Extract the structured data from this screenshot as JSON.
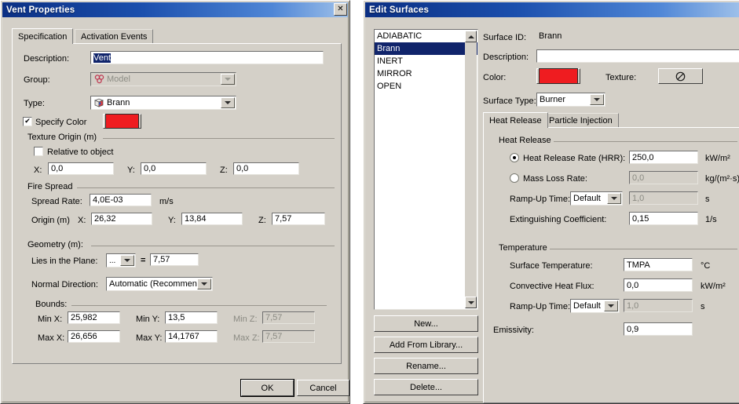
{
  "vent_dialog": {
    "title": "Vent Properties",
    "close_icon": "close-icon",
    "tabs": [
      {
        "label": "Specification",
        "active": true
      },
      {
        "label": "Activation Events",
        "active": false
      }
    ],
    "fields": {
      "description_label": "Description:",
      "description_value": "Vent",
      "group_label": "Group:",
      "group_value": "Model",
      "type_label": "Type:",
      "type_value": "Brann",
      "specify_color_label": "Specify Color",
      "specify_color_checked": "✔",
      "color_swatch": "#ef1c20"
    },
    "texture_origin": {
      "title": "Texture Origin (m)",
      "relative_label": "Relative to object",
      "x_label": "X:",
      "x_value": "0,0",
      "y_label": "Y:",
      "y_value": "0,0",
      "z_label": "Z:",
      "z_value": "0,0"
    },
    "fire_spread": {
      "title": "Fire Spread",
      "spread_rate_label": "Spread Rate:",
      "spread_rate_value": "4,0E-03",
      "spread_rate_unit": "m/s",
      "origin_label": "Origin (m)",
      "x_label": "X:",
      "x_value": "26,32",
      "y_label": "Y:",
      "y_value": "13,84",
      "z_label": "Z:",
      "z_value": "7,57"
    },
    "geometry": {
      "title": "Geometry (m):",
      "plane_label": "Lies in the Plane:",
      "plane_value": "...",
      "equals": "=",
      "plane_coord": "7,57",
      "normal_label": "Normal Direction:",
      "normal_value": "Automatic (Recommend...",
      "bounds_title": "Bounds:",
      "min_x_label": "Min X:",
      "min_x_value": "25,982",
      "min_y_label": "Min Y:",
      "min_y_value": "13,5",
      "min_z_label": "Min Z:",
      "min_z_value": "7,57",
      "max_x_label": "Max X:",
      "max_x_value": "26,656",
      "max_y_label": "Max Y:",
      "max_y_value": "14,1767",
      "max_z_label": "Max Z:",
      "max_z_value": "7,57"
    },
    "buttons": {
      "ok": "OK",
      "cancel": "Cancel"
    }
  },
  "surfaces_dialog": {
    "title": "Edit Surfaces",
    "list": {
      "items": [
        "ADIABATIC",
        "Brann",
        "INERT",
        "MIRROR",
        "OPEN"
      ],
      "selected": "Brann"
    },
    "list_buttons": [
      {
        "label": "New..."
      },
      {
        "label": "Add From Library..."
      },
      {
        "label": "Rename..."
      },
      {
        "label": "Delete..."
      }
    ],
    "fields": {
      "surface_id_label": "Surface ID:",
      "surface_id_value": "Brann",
      "description_label": "Description:",
      "description_value": "",
      "color_label": "Color:",
      "color_swatch": "#ef1c20",
      "texture_label": "Texture:",
      "texture_icon": "no-texture-icon",
      "surface_type_label": "Surface Type:",
      "surface_type_value": "Burner"
    },
    "tabs": [
      {
        "label": "Heat Release",
        "active": true
      },
      {
        "label": "Particle Injection",
        "active": false
      }
    ],
    "heat_release": {
      "title": "Heat Release",
      "hrr_label": "Heat Release Rate (HRR):",
      "hrr_selected": true,
      "hrr_value": "250,0",
      "hrr_unit": "kW/m²",
      "mlr_label": "Mass Loss Rate:",
      "mlr_selected": false,
      "mlr_value": "0,0",
      "mlr_unit": "kg/(m²·s)",
      "ramp_label": "Ramp-Up Time:",
      "ramp_value": "Default",
      "ramp_time_value": "1,0",
      "ramp_unit": "s",
      "exting_label": "Extinguishing Coefficient:",
      "exting_value": "0,15",
      "exting_unit": "1/s"
    },
    "temperature": {
      "title": "Temperature",
      "surface_temp_label": "Surface Temperature:",
      "surface_temp_value": "TMPA",
      "surface_temp_unit": "°C",
      "conv_flux_label": "Convective Heat Flux:",
      "conv_flux_value": "0,0",
      "conv_flux_unit": "kW/m²",
      "ramp_label": "Ramp-Up Time:",
      "ramp_value": "Default",
      "ramp_time_value": "1,0",
      "ramp_unit": "s",
      "emissivity_label": "Emissivity:",
      "emissivity_value": "0,9"
    }
  }
}
